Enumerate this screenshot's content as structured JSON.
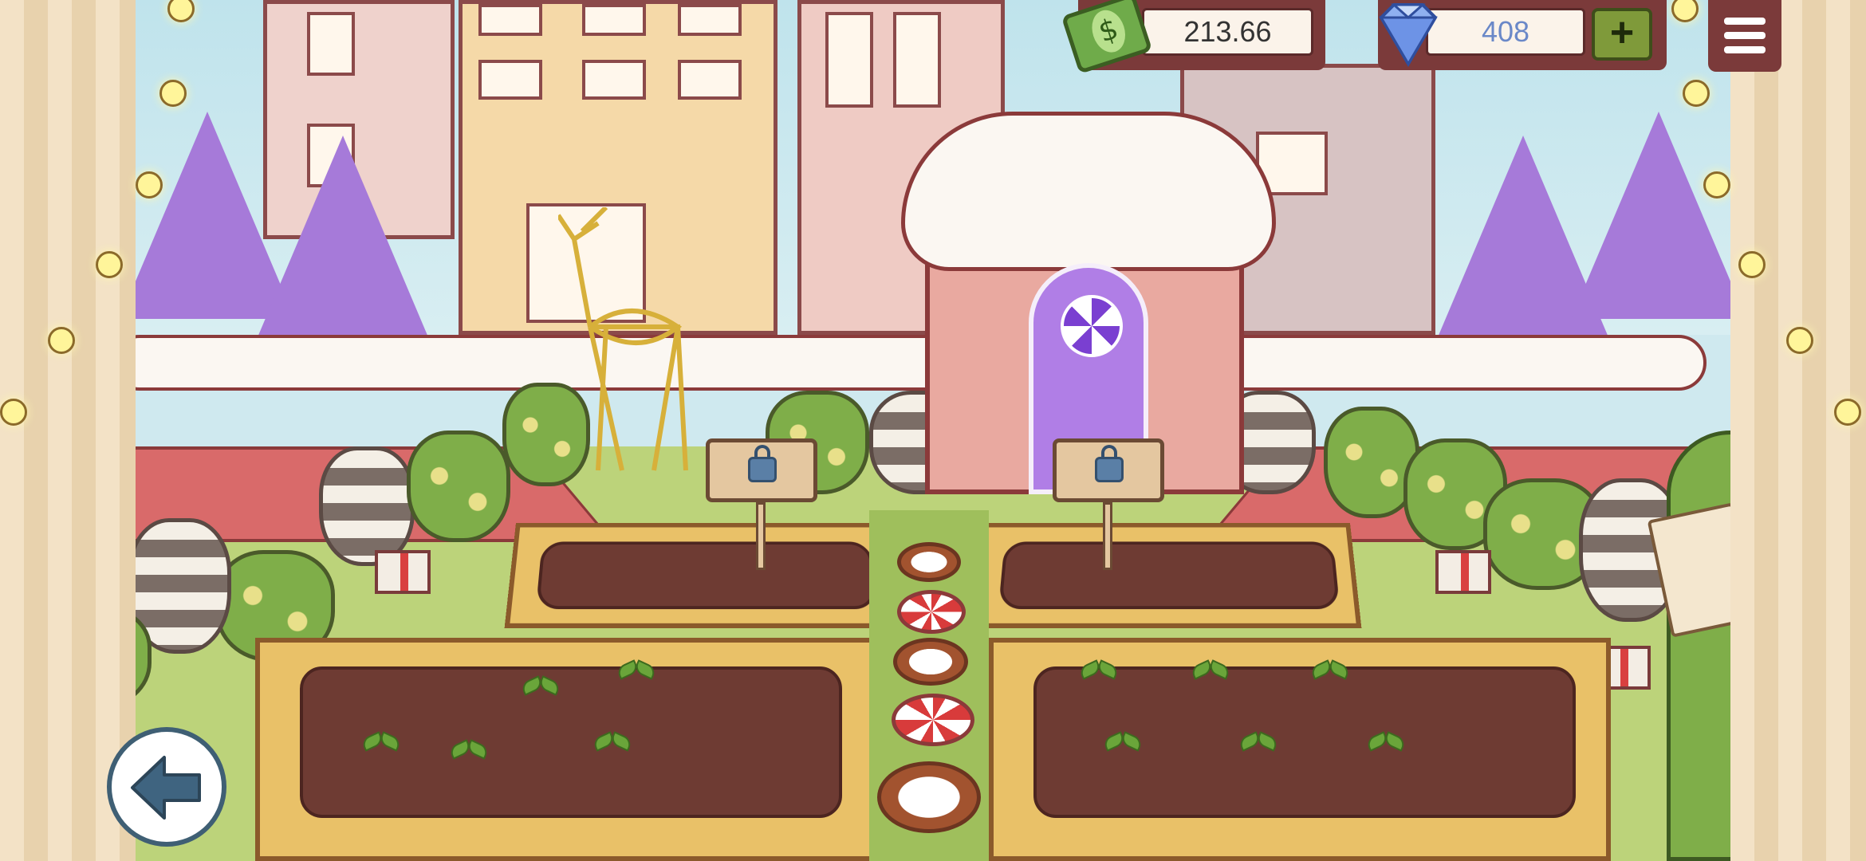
{
  "hud": {
    "money_value": "213.66",
    "gems_value": "408",
    "add_gems_label": "+",
    "money_icon": "cash-bill-icon",
    "gem_icon": "diamond-icon",
    "menu_icon": "hamburger-menu-icon",
    "back_icon": "back-arrow-icon"
  },
  "scene": {
    "locked_plots": 2,
    "garden_beds": 4,
    "lock_icon": "padlock-icon"
  },
  "colors": {
    "hud_background": "#7b3a3a",
    "hud_field": "#fbf3ea",
    "gem_text": "#6a88c8",
    "plus_button": "#7f9a3a",
    "soil": "#6e3b33",
    "bed_frame": "#e9c168",
    "grass": "#bcd37a"
  }
}
